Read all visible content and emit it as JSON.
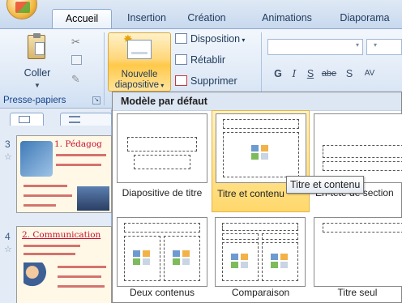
{
  "tabs": [
    {
      "label": "Accueil",
      "active": true
    },
    {
      "label": "Insertion",
      "active": false
    },
    {
      "label": "Création",
      "active": false
    },
    {
      "label": "Animations",
      "active": false
    },
    {
      "label": "Diaporama",
      "active": false
    }
  ],
  "clipboard": {
    "paste_label": "Coller",
    "group_label": "Presse-papiers"
  },
  "slides_group": {
    "new_slide_line1": "Nouvelle",
    "new_slide_line2": "diapositive",
    "layout_label": "Disposition",
    "reset_label": "Rétablir",
    "delete_label": "Supprimer"
  },
  "font_buttons": {
    "bold": "G",
    "italic": "I",
    "underline": "S",
    "strike": "abe",
    "shadow": "S",
    "spacing": "AV"
  },
  "gallery": {
    "header": "Modèle par défaut",
    "layouts": [
      {
        "caption": "Diapositive de titre"
      },
      {
        "caption": "Titre et contenu"
      },
      {
        "caption": "En-tête de section"
      },
      {
        "caption": "Deux contenus"
      },
      {
        "caption": "Comparaison"
      },
      {
        "caption": "Titre seul"
      }
    ],
    "tooltip": "Titre et contenu"
  },
  "slides_panel": {
    "slides": [
      {
        "number": "3",
        "title": "1. Pédagog"
      },
      {
        "number": "4",
        "title": "2. Communication"
      }
    ]
  },
  "colors": {
    "accent": "#ffd86c",
    "ribbon": "#dde8f6",
    "title_text": "#c8102e"
  }
}
